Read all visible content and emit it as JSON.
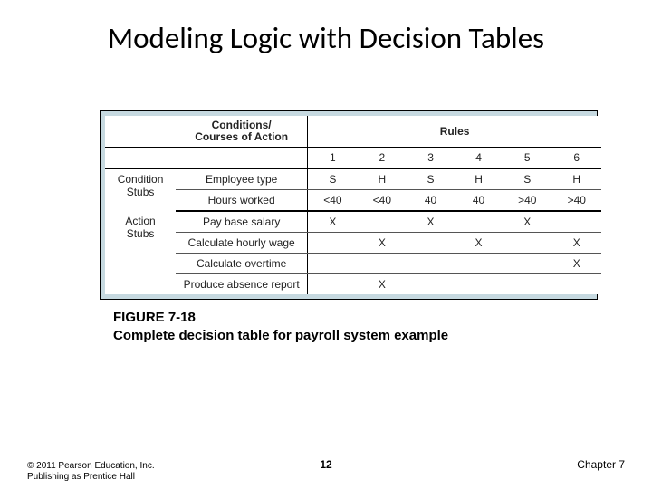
{
  "title": "Modeling Logic with Decision Tables",
  "table": {
    "header": {
      "conditions_label": "Conditions/\nCourses of Action",
      "rules_label": "Rules",
      "rule_nums": [
        "1",
        "2",
        "3",
        "4",
        "5",
        "6"
      ]
    },
    "stubs": {
      "condition": "Condition Stubs",
      "action": "Action Stubs"
    },
    "rows": [
      {
        "label": "Employee type",
        "cells": [
          "S",
          "H",
          "S",
          "H",
          "S",
          "H"
        ]
      },
      {
        "label": "Hours worked",
        "cells": [
          "<40",
          "<40",
          "40",
          "40",
          ">40",
          ">40"
        ]
      },
      {
        "label": "Pay base salary",
        "cells": [
          "X",
          "",
          "X",
          "",
          "X",
          ""
        ]
      },
      {
        "label": "Calculate hourly wage",
        "cells": [
          "",
          "X",
          "",
          "X",
          "",
          "X"
        ]
      },
      {
        "label": "Calculate overtime",
        "cells": [
          "",
          "",
          "",
          "",
          "",
          "X"
        ]
      },
      {
        "label": "Produce absence report",
        "cells": [
          "",
          "X",
          "",
          "",
          "",
          ""
        ]
      }
    ]
  },
  "caption": {
    "fig": "FIGURE 7-18",
    "text": "Complete decision table for payroll system example"
  },
  "footer": {
    "copyright": "© 2011 Pearson Education, Inc. Publishing as Prentice Hall",
    "page": "12",
    "chapter": "Chapter 7"
  }
}
